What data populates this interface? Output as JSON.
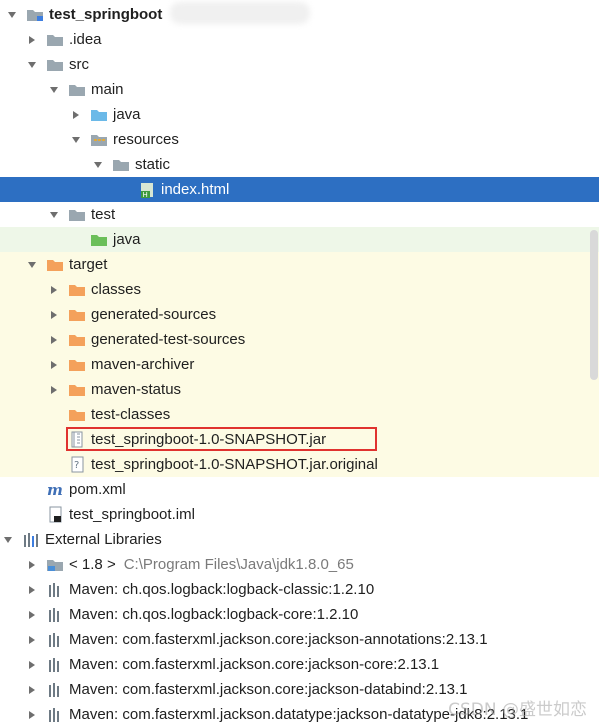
{
  "colors": {
    "selection": "#2d6fc2",
    "test_bg": "#eef7e8",
    "excluded_bg": "#fdfbe4",
    "folder_gray": "#9aa7b0",
    "folder_blue": "#6bb9e8",
    "folder_green": "#6bbf5a",
    "folder_orange": "#f4a15b",
    "highlight_box": "#e0322f"
  },
  "tree": {
    "rows": [
      {
        "label": "test_springboot",
        "icon": "module-folder-icon",
        "bold": true
      },
      {
        "label": ".idea",
        "icon": "folder-icon"
      },
      {
        "label": "src",
        "icon": "folder-icon"
      },
      {
        "label": "main",
        "icon": "folder-icon"
      },
      {
        "label": "java",
        "icon": "source-folder-icon"
      },
      {
        "label": "resources",
        "icon": "resources-folder-icon"
      },
      {
        "label": "static",
        "icon": "folder-icon"
      },
      {
        "label": "index.html",
        "icon": "html-file-icon"
      },
      {
        "label": "test",
        "icon": "folder-icon"
      },
      {
        "label": "java",
        "icon": "test-folder-icon"
      },
      {
        "label": "target",
        "icon": "excluded-folder-icon"
      },
      {
        "label": "classes",
        "icon": "excluded-folder-icon"
      },
      {
        "label": "generated-sources",
        "icon": "excluded-folder-icon"
      },
      {
        "label": "generated-test-sources",
        "icon": "excluded-folder-icon"
      },
      {
        "label": "maven-archiver",
        "icon": "excluded-folder-icon"
      },
      {
        "label": "maven-status",
        "icon": "excluded-folder-icon"
      },
      {
        "label": "test-classes",
        "icon": "excluded-folder-icon"
      },
      {
        "label": "test_springboot-1.0-SNAPSHOT.jar",
        "icon": "jar-file-icon"
      },
      {
        "label": "test_springboot-1.0-SNAPSHOT.jar.original",
        "icon": "unknown-file-icon"
      },
      {
        "label": "pom.xml",
        "icon": "maven-pom-icon"
      },
      {
        "label": "test_springboot.iml",
        "icon": "iml-file-icon"
      },
      {
        "label": "External Libraries",
        "icon": "libraries-icon"
      },
      {
        "label": "< 1.8 >",
        "extra": "C:\\Program Files\\Java\\jdk1.8.0_65",
        "icon": "jdk-icon"
      },
      {
        "label": "Maven: ch.qos.logback:logback-classic:1.2.10",
        "icon": "library-icon"
      },
      {
        "label": "Maven: ch.qos.logback:logback-core:1.2.10",
        "icon": "library-icon"
      },
      {
        "label": "Maven: com.fasterxml.jackson.core:jackson-annotations:2.13.1",
        "icon": "library-icon"
      },
      {
        "label": "Maven: com.fasterxml.jackson.core:jackson-core:2.13.1",
        "icon": "library-icon"
      },
      {
        "label": "Maven: com.fasterxml.jackson.core:jackson-databind:2.13.1",
        "icon": "library-icon"
      },
      {
        "label": "Maven: com.fasterxml.jackson.datatype:jackson-datatype-jdk8:2.13.1",
        "icon": "library-icon"
      }
    ]
  },
  "watermark": "CSDN @盛世如恋"
}
